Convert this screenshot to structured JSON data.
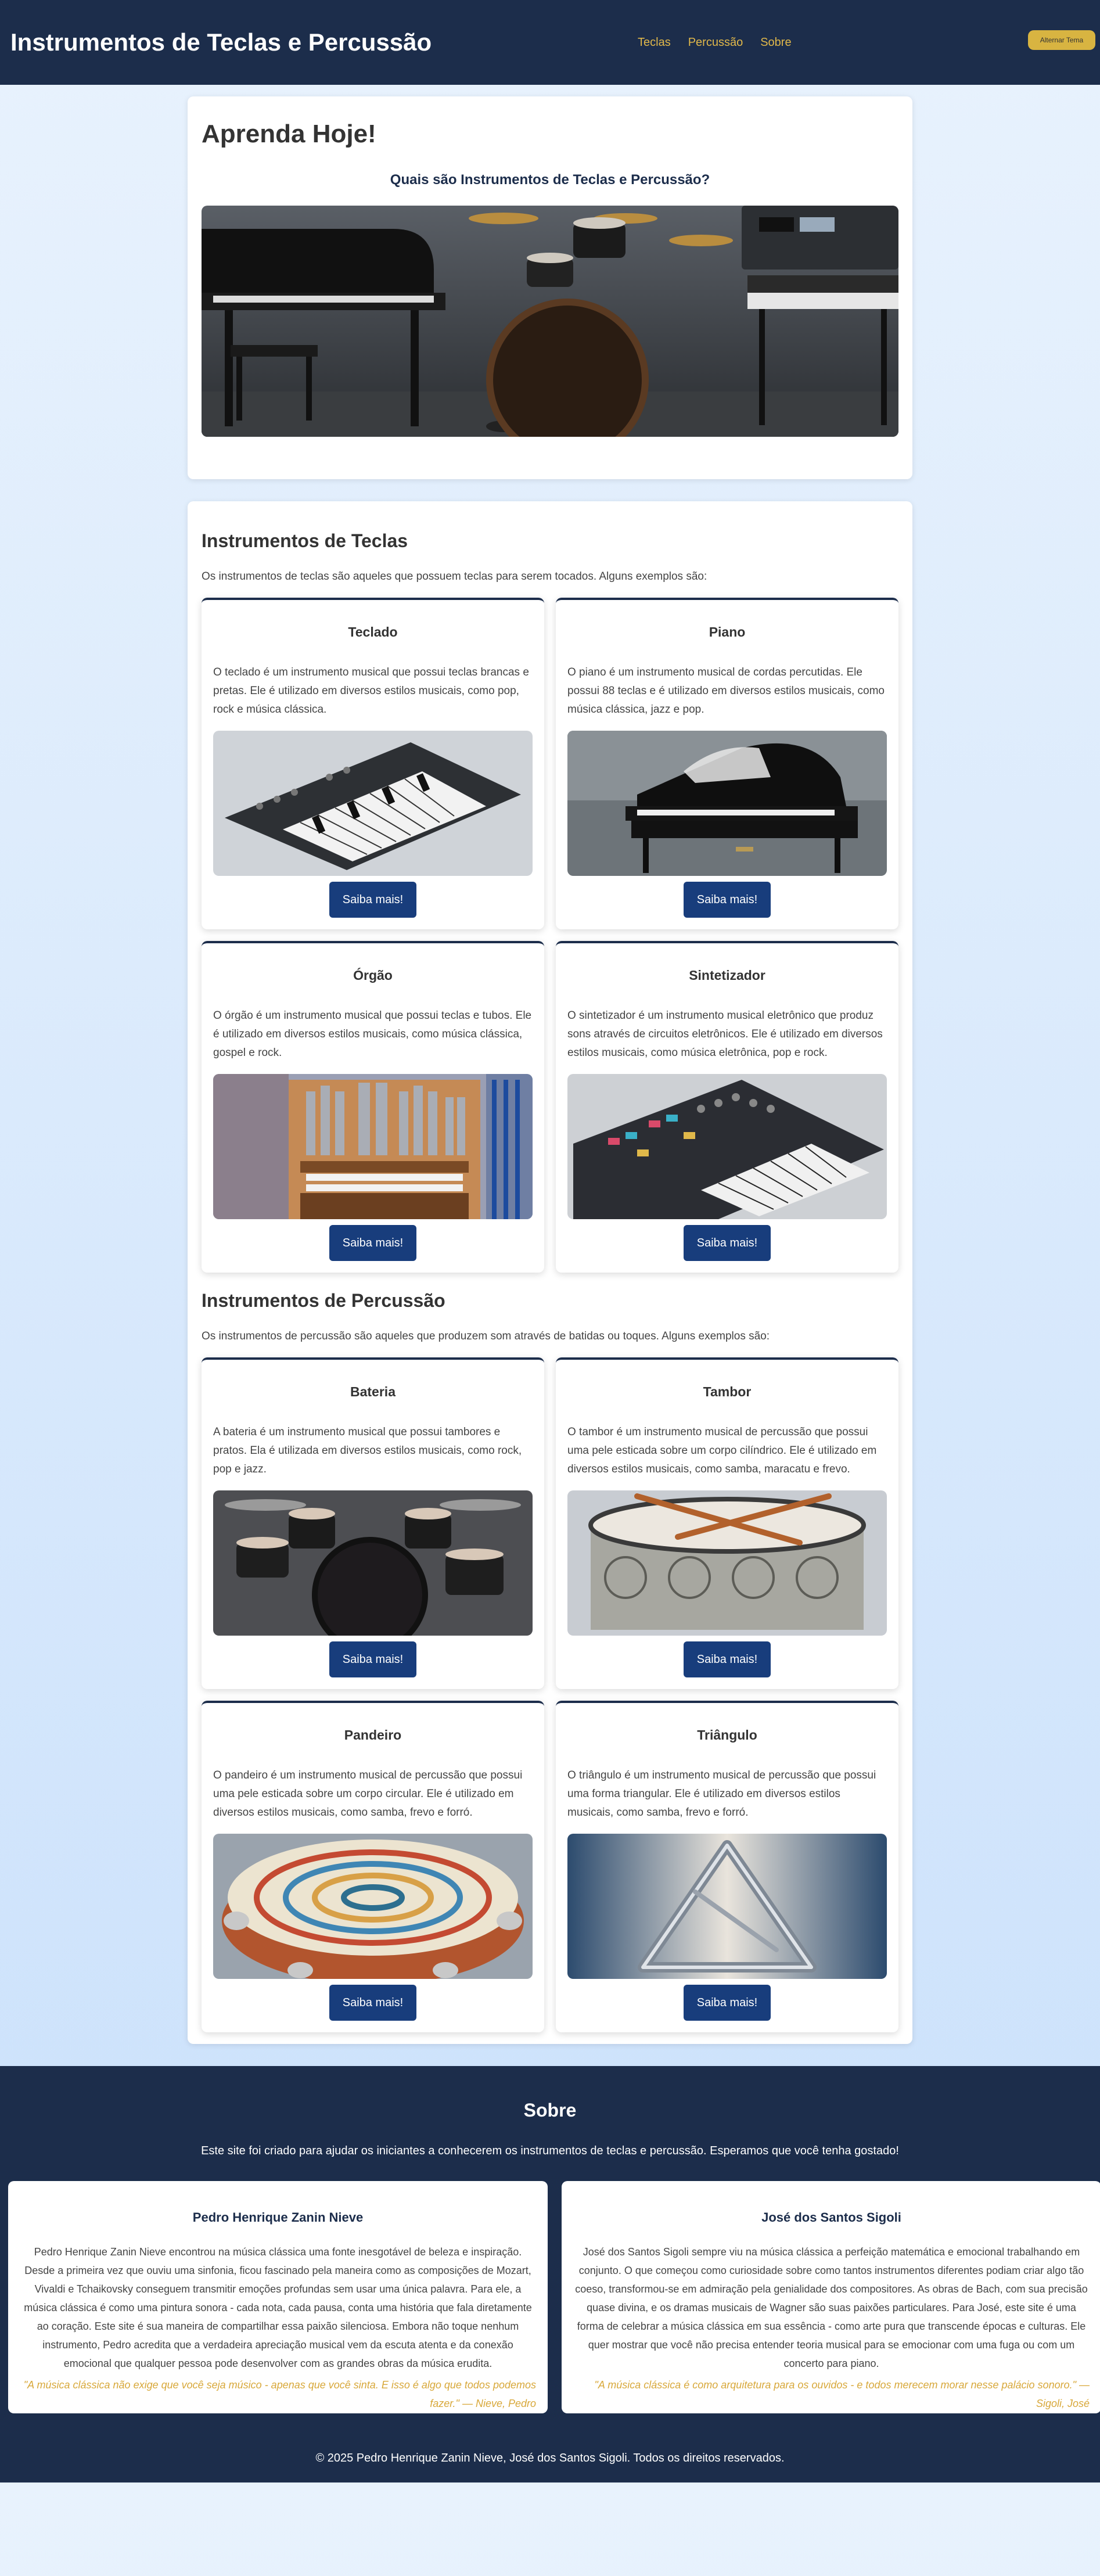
{
  "header": {
    "title": "Instrumentos de Teclas e Percussão",
    "nav": [
      "Teclas",
      "Percussão",
      "Sobre"
    ],
    "theme_button": "Alternar Tema"
  },
  "hero": {
    "heading": "Aprenda Hoje!",
    "subheading": "Quais são Instrumentos de Teclas e Percussão?"
  },
  "teclas": {
    "title": "Instrumentos de Teclas",
    "intro": "Os instrumentos de teclas são aqueles que possuem teclas para serem tocados. Alguns exemplos são:",
    "cards": [
      {
        "name": "Teclado",
        "text": "O teclado é um instrumento musical que possui teclas brancas e pretas. Ele é utilizado em diversos estilos musicais, como pop, rock e música clássica.",
        "button": "Saiba mais!",
        "icon": "keyboard-image"
      },
      {
        "name": "Piano",
        "text": "O piano é um instrumento musical de cordas percutidas. Ele possui 88 teclas e é utilizado em diversos estilos musicais, como música clássica, jazz e pop.",
        "button": "Saiba mais!",
        "icon": "piano-image"
      },
      {
        "name": "Órgão",
        "text": "O órgão é um instrumento musical que possui teclas e tubos. Ele é utilizado em diversos estilos musicais, como música clássica, gospel e rock.",
        "button": "Saiba mais!",
        "icon": "organ-image"
      },
      {
        "name": "Sintetizador",
        "text": "O sintetizador é um instrumento musical eletrônico que produz sons através de circuitos eletrônicos. Ele é utilizado em diversos estilos musicais, como música eletrônica, pop e rock.",
        "button": "Saiba mais!",
        "icon": "synthesizer-image"
      }
    ]
  },
  "percussao": {
    "title": "Instrumentos de Percussão",
    "intro": "Os instrumentos de percussão são aqueles que produzem som através de batidas ou toques. Alguns exemplos são:",
    "cards": [
      {
        "name": "Bateria",
        "text": "A bateria é um instrumento musical que possui tambores e pratos. Ela é utilizada em diversos estilos musicais, como rock, pop e jazz.",
        "button": "Saiba mais!",
        "icon": "drumkit-image"
      },
      {
        "name": "Tambor",
        "text": "O tambor é um instrumento musical de percussão que possui uma pele esticada sobre um corpo cilíndrico. Ele é utilizado em diversos estilos musicais, como samba, maracatu e frevo.",
        "button": "Saiba mais!",
        "icon": "drum-image"
      },
      {
        "name": "Pandeiro",
        "text": "O pandeiro é um instrumento musical de percussão que possui uma pele esticada sobre um corpo circular. Ele é utilizado em diversos estilos musicais, como samba, frevo e forró.",
        "button": "Saiba mais!",
        "icon": "tambourine-image"
      },
      {
        "name": "Triângulo",
        "text": "O triângulo é um instrumento musical de percussão que possui uma forma triangular. Ele é utilizado em diversos estilos musicais, como samba, frevo e forró.",
        "button": "Saiba mais!",
        "icon": "triangle-image"
      }
    ]
  },
  "sobre": {
    "title": "Sobre",
    "intro": "Este site foi criado para ajudar os iniciantes a conhecerem os instrumentos de teclas e percussão. Esperamos que você tenha gostado!",
    "bios": [
      {
        "name": "Pedro Henrique Zanin Nieve",
        "text": "Pedro Henrique Zanin Nieve encontrou na música clássica uma fonte inesgotável de beleza e inspiração. Desde a primeira vez que ouviu uma sinfonia, ficou fascinado pela maneira como as composições de Mozart, Vivaldi e Tchaikovsky conseguem transmitir emoções profundas sem usar uma única palavra. Para ele, a música clássica é como uma pintura sonora - cada nota, cada pausa, conta uma história que fala diretamente ao coração. Este site é sua maneira de compartilhar essa paixão silenciosa. Embora não toque nenhum instrumento, Pedro acredita que a verdadeira apreciação musical vem da escuta atenta e da conexão emocional que qualquer pessoa pode desenvolver com as grandes obras da música erudita.",
        "quote": "\"A música clássica não exige que você seja músico - apenas que você sinta. E isso é algo que todos podemos fazer.\" — Nieve, Pedro"
      },
      {
        "name": "José dos Santos Sigoli",
        "text": "José dos Santos Sigoli sempre viu na música clássica a perfeição matemática e emocional trabalhando em conjunto. O que começou como curiosidade sobre como tantos instrumentos diferentes podiam criar algo tão coeso, transformou-se em admiração pela genialidade dos compositores. As obras de Bach, com sua precisão quase divina, e os dramas musicais de Wagner são suas paixões particulares. Para José, este site é uma forma de celebrar a música clássica em sua essência - como arte pura que transcende épocas e culturas. Ele quer mostrar que você não precisa entender teoria musical para se emocionar com uma fuga ou com um concerto para piano.",
        "quote": "\"A música clássica é como arquitetura para os ouvidos - e todos merecem morar nesse palácio sonoro.\" — Sigoli, José"
      }
    ],
    "footer": "© 2025 Pedro Henrique Zanin Nieve, José dos Santos Sigoli. Todos os direitos reservados."
  }
}
